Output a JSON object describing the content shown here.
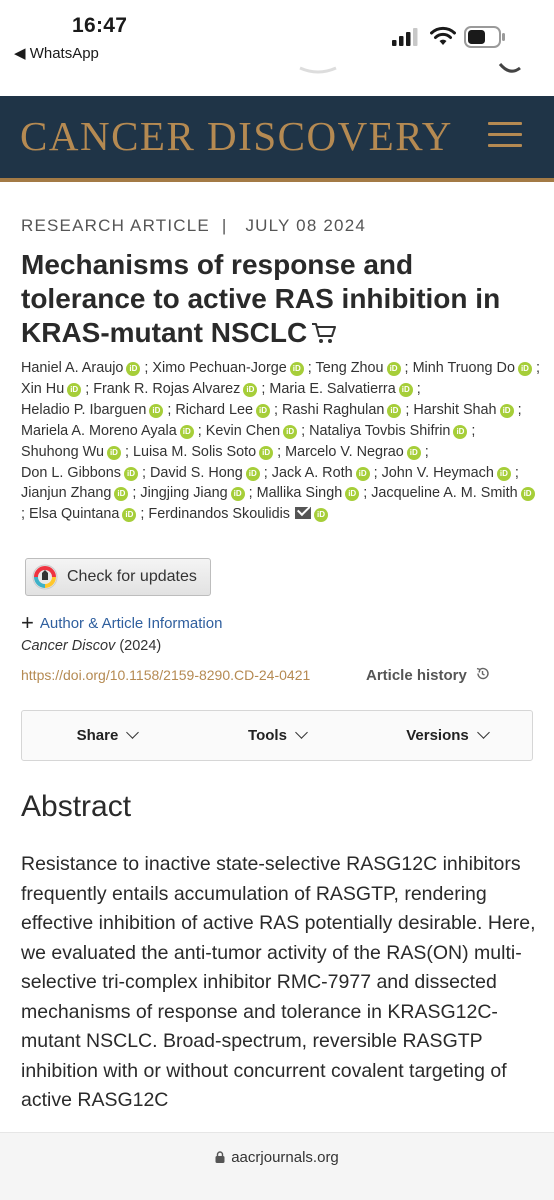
{
  "status_bar": {
    "time": "16:47",
    "back_label": "◀ WhatsApp",
    "icons": [
      "signal-icon",
      "wifi-icon",
      "battery-icon"
    ]
  },
  "journal": {
    "title": "CANCER DISCOVERY",
    "colors": {
      "header_bg": "#1f3447",
      "title": "#b58a52",
      "rule": "#a37a45"
    }
  },
  "article": {
    "type": "RESEARCH ARTICLE",
    "separator": "|",
    "date": "JULY 08 2024",
    "title": "Mechanisms of response and tolerance to active RAS inhibition in KRAS-mutant NSCLC",
    "authors": [
      "Haniel A. Araujo",
      "Ximo Pechuan-Jorge",
      "Teng Zhou",
      "Minh Truong Do",
      "Xin Hu",
      "Frank R. Rojas Alvarez",
      "Maria E. Salvatierra",
      "Heladio P. Ibarguen",
      "Richard Lee",
      "Rashi Raghulan",
      "Harshit Shah",
      "Mariela A. Moreno Ayala",
      "Kevin Chen",
      "Nataliya Tovbis Shifrin",
      "Shuhong Wu",
      "Luisa M. Solis Soto",
      "Marcelo V. Negrao",
      "Don L. Gibbons",
      "David S. Hong",
      "Jack A. Roth",
      "John V. Heymach",
      "Jianjun Zhang",
      "Jingjing Jiang",
      "Mallika Singh",
      "Jacqueline A. M. Smith",
      "Elsa Quintana",
      "Ferdinandos Skoulidis"
    ],
    "orcid_label": "iD",
    "check_updates_label": "Check for updates",
    "author_info_label": "Author & Article Information",
    "citation_journal": "Cancer Discov",
    "citation_year": "(2024)",
    "doi": "https://doi.org/10.1158/2159-8290.CD-24-0421",
    "history_label": "Article history"
  },
  "toolbar": {
    "share": "Share",
    "tools": "Tools",
    "versions": "Versions"
  },
  "abstract": {
    "heading": "Abstract",
    "text": "Resistance to inactive state-selective RASG12C inhibitors frequently entails accumulation of RASGTP, rendering effective inhibition of active RAS potentially desirable. Here, we evaluated the anti-tumor activity of the RAS(ON) multi-selective tri-complex inhibitor RMC-7977 and dissected mechanisms of response and tolerance in KRASG12C-mutant NSCLC. Broad-spectrum, reversible RASGTP inhibition with or without concurrent covalent targeting of active RASG12C"
  },
  "browser": {
    "address": "aacrjournals.org"
  }
}
